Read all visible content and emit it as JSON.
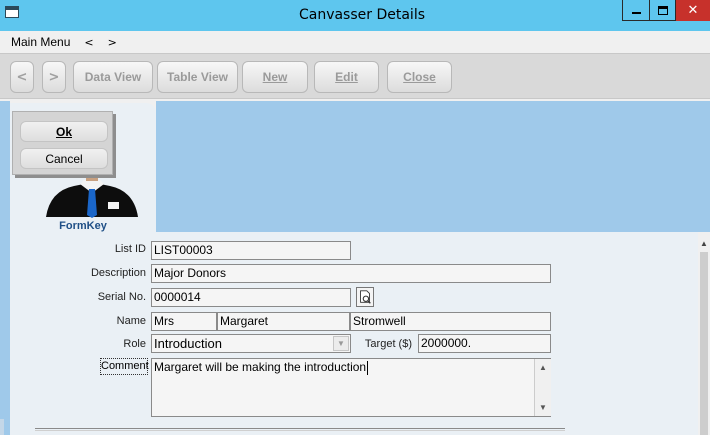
{
  "window": {
    "title": "Canvasser Details",
    "close_glyph": "✕"
  },
  "menu": {
    "main_menu": "Main Menu",
    "back": "<",
    "forward": ">"
  },
  "toolbar": {
    "back": "<",
    "forward": ">",
    "data_view": "Data View",
    "table_view": "Table View",
    "new": "New",
    "edit": "Edit",
    "close": "Close"
  },
  "dialog": {
    "ok": "Ok",
    "cancel": "Cancel"
  },
  "formkey": {
    "label": "FormKey"
  },
  "form": {
    "list_id": {
      "label": "List ID",
      "value": "LIST00003"
    },
    "description": {
      "label": "Description",
      "value": "Major Donors"
    },
    "serial_no": {
      "label": "Serial No.",
      "value": "0000014"
    },
    "name": {
      "label": "Name",
      "title": "Mrs",
      "first": "Margaret",
      "last": "Stromwell"
    },
    "role": {
      "label": "Role",
      "value": "Introduction"
    },
    "target": {
      "label": "Target ($)",
      "value": "2000000."
    },
    "comment": {
      "label": "Comment",
      "value": "Margaret will be making the introduction"
    }
  },
  "colors": {
    "titlebar": "#5ec6ee",
    "close_button": "#c7312b",
    "header_blue": "#9fc9ea",
    "form_background": "#eaf0f5",
    "formkey_text": "#1f4f86"
  },
  "icons": [
    "app-icon",
    "minimize-icon",
    "maximize-icon",
    "close-icon",
    "avatar-icon",
    "serial-lookup-icon",
    "dropdown-arrow-icon",
    "scroll-up-icon",
    "scroll-down-icon"
  ]
}
